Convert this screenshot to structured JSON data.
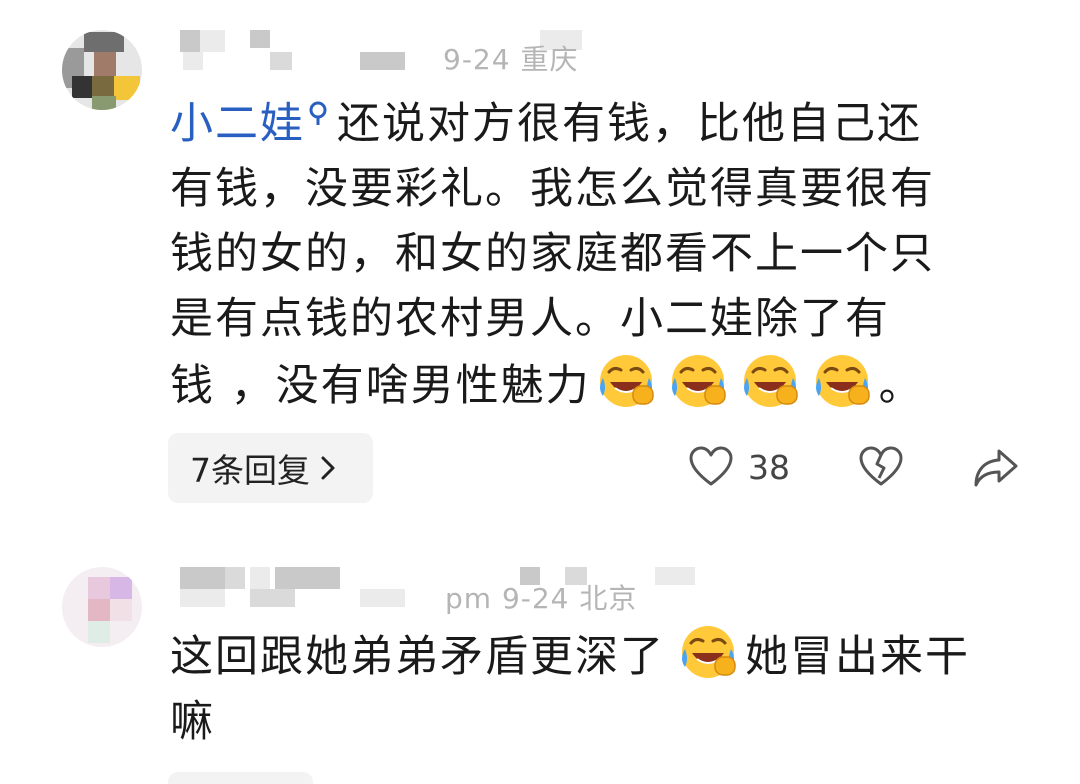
{
  "comments": [
    {
      "meta_visible": "9-24  重庆",
      "mention": "小二娃",
      "text_lines": [
        "还说对方很有钱，比他自己还",
        "有钱，没要彩礼。我怎么觉得真要很有",
        "钱的女的，和女的家庭都看不上一个只",
        "是有点钱的农村男人。小二娃除了有",
        "钱 ，没有啥男性魅力"
      ],
      "trailing": "。",
      "emoji_name": "face-with-tears-of-joy-emoji",
      "emoji_count": 4,
      "replies_label": "7条回复",
      "like_count": "38"
    },
    {
      "meta_visible": "pm  9-24  北京",
      "text_line1_before_emoji": "这回跟她弟弟矛盾更深了",
      "text_line1_after_emoji": "她冒出来干",
      "text_line2": "嘛",
      "emoji_name": "face-with-tears-of-joy-emoji"
    }
  ],
  "icons": {
    "mention": "search-person-icon",
    "replies_chevron": "chevron-right-icon",
    "like": "heart-outline-icon",
    "dislike": "broken-heart-icon",
    "share": "share-arrow-icon"
  },
  "colors": {
    "mention": "#2a5fc2",
    "replies_bg": "#f3f3f3",
    "meta_gray": "#b5b5b5"
  }
}
